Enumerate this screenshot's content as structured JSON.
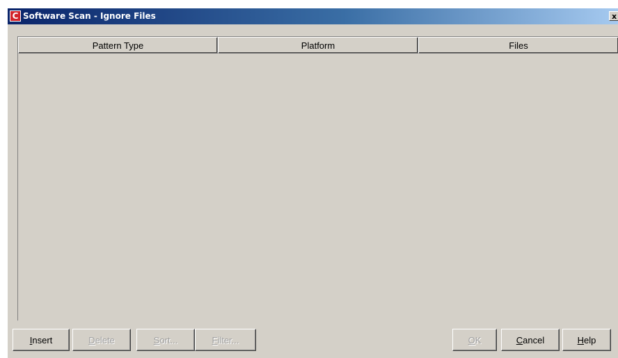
{
  "window": {
    "title": "Software Scan - Ignore Files",
    "icon_letter": "C",
    "close_label": "x"
  },
  "table": {
    "columns": [
      "Pattern Type",
      "Platform",
      "Files"
    ],
    "rows": []
  },
  "buttons": {
    "insert": {
      "mnemonic": "I",
      "rest": "nsert",
      "enabled": true
    },
    "delete": {
      "mnemonic": "D",
      "rest": "elete",
      "enabled": false
    },
    "sort": {
      "mnemonic": "S",
      "rest": "ort...",
      "enabled": false
    },
    "filter": {
      "mnemonic": "F",
      "rest": "ilter...",
      "enabled": false
    },
    "ok": {
      "mnemonic": "O",
      "rest": "K",
      "enabled": false
    },
    "cancel": {
      "mnemonic": "C",
      "rest": "ancel",
      "enabled": true
    },
    "help": {
      "mnemonic": "H",
      "rest": "elp",
      "enabled": true
    }
  },
  "colors": {
    "dialog_bg": "#d4d0c8",
    "title_gradient_start": "#0a246a",
    "title_gradient_end": "#a6caf0",
    "app_icon_red": "#d2232a",
    "disabled_text": "#a0a0a0"
  },
  "icons": {
    "app": "app-logo-icon",
    "close": "close-icon"
  }
}
